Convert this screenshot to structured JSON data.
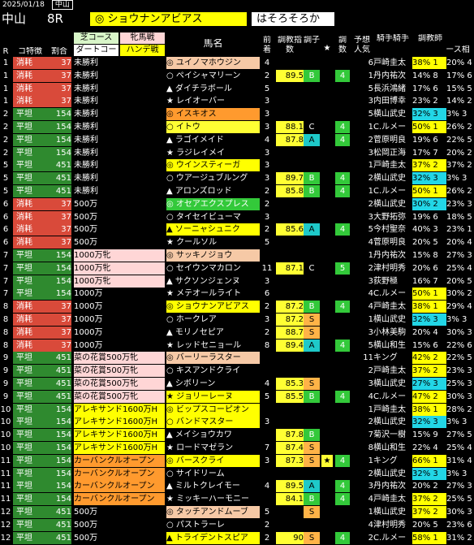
{
  "top": {
    "date": "2025/01/18",
    "venue": "中山"
  },
  "title": {
    "venue": "中山",
    "race": "8R",
    "pick": "◎ ショウナンアビアス",
    "note": "はそろそろか"
  },
  "headers": {
    "r": "R",
    "cond": "コ特徴",
    "ratio": "割合",
    "course_turf": "芝コース",
    "course_dirt": "ダートコー",
    "mare": "牝馬戦",
    "handicap": "ハンデ戦",
    "horse": "馬名",
    "prev": "前着",
    "index": "調教指数",
    "cond2": "調子",
    "star": "★",
    "cnt": "調数",
    "pred": "予想人気",
    "jockey": "騎手騎手",
    "trainer": "調教師",
    "rate": "ース相"
  },
  "rows": [
    {
      "r": "1",
      "feat": "消耗",
      "pct": "37",
      "cls": "未勝利",
      "mark": "◎",
      "name": "ユイノマホウジン",
      "nc": "peach",
      "prev": "4",
      "idx": "",
      "cnd": "",
      "cc": "",
      "star": "",
      "cnt": "",
      "pred": "6",
      "jk": "戸崎圭太",
      "pc": "38% 1",
      "pcc": "pc-y",
      "rt": "20% 4"
    },
    {
      "r": "1",
      "feat": "消耗",
      "pct": "37",
      "cls": "未勝利",
      "mark": "○",
      "name": "ペイシャマリーン",
      "nc": "",
      "prev": "2",
      "idx": "89.5",
      "cnd": "B",
      "cc": "rank-g",
      "star": "",
      "cnt": "4",
      "pred": "1",
      "jk": "丹内祐次",
      "pc": "14% 8",
      "pcc": "",
      "rt": "17% 6"
    },
    {
      "r": "1",
      "feat": "消耗",
      "pct": "37",
      "cls": "未勝利",
      "mark": "▲",
      "name": "ダイチラボール",
      "nc": "",
      "prev": "5",
      "idx": "",
      "cnd": "",
      "cc": "",
      "star": "",
      "cnt": "",
      "pred": "5",
      "jk": "長浜鴻緒",
      "pc": "17% 6",
      "pcc": "",
      "rt": "15% 5"
    },
    {
      "r": "1",
      "feat": "消耗",
      "pct": "37",
      "cls": "未勝利",
      "mark": "★",
      "name": "レイオーバー",
      "nc": "",
      "prev": "3",
      "idx": "",
      "cnd": "",
      "cc": "",
      "star": "",
      "cnt": "",
      "pred": "3",
      "jk": "内田博幸",
      "pc": "23% 2",
      "pcc": "",
      "rt": "14% 2"
    },
    {
      "r": "2",
      "feat": "平坦",
      "pct": "154",
      "cls": "未勝利",
      "mark": "◎",
      "name": "イスキオス",
      "nc": "orange",
      "prev": "3",
      "idx": "",
      "cnd": "",
      "cc": "",
      "star": "",
      "cnt": "",
      "pred": "5",
      "jk": "横山武史",
      "pc": "32% 3",
      "pcc": "pc-c",
      "rt": "3% 3"
    },
    {
      "r": "2",
      "feat": "平坦",
      "pct": "154",
      "cls": "未勝利",
      "mark": "○",
      "name": "イトウ",
      "nc": "lemon",
      "prev": "3",
      "idx": "88.1",
      "cnd": "C",
      "cc": "",
      "star": "",
      "cnt": "4",
      "pred": "1",
      "jk": "C.ルメー",
      "pc": "50% 1",
      "pcc": "pc-y",
      "rt": "26% 2"
    },
    {
      "r": "2",
      "feat": "平坦",
      "pct": "154",
      "cls": "未勝利",
      "mark": "▲",
      "name": "ラゴイメイド",
      "nc": "",
      "prev": "4",
      "idx": "87.8",
      "cnd": "A",
      "cc": "rank-c",
      "star": "",
      "cnt": "4",
      "pred": "2",
      "jk": "菅原明良",
      "pc": "19% 6",
      "pcc": "",
      "rt": "22% 5"
    },
    {
      "r": "2",
      "feat": "平坦",
      "pct": "154",
      "cls": "未勝利",
      "mark": "★",
      "name": "ラジレイメイ",
      "nc": "",
      "prev": "3",
      "idx": "",
      "cnd": "",
      "cc": "",
      "star": "",
      "cnt": "",
      "pred": "3",
      "jk": "松岡正海",
      "pc": "17% 7",
      "pcc": "",
      "rt": "20% 2"
    },
    {
      "r": "5",
      "feat": "平坦",
      "pct": "451",
      "cls": "未勝利",
      "mark": "◎",
      "name": "ウインスティーガ",
      "nc": "yel",
      "prev": "3",
      "idx": "",
      "cnd": "",
      "cc": "",
      "star": "",
      "cnt": "",
      "pred": "1",
      "jk": "戸崎圭太",
      "pc": "37% 2",
      "pcc": "pc-y",
      "rt": "37% 2"
    },
    {
      "r": "5",
      "feat": "平坦",
      "pct": "451",
      "cls": "未勝利",
      "mark": "○",
      "name": "ウアージュブルング",
      "nc": "",
      "prev": "3",
      "idx": "89.7",
      "cnd": "B",
      "cc": "rank-g",
      "star": "",
      "cnt": "4",
      "pred": "2",
      "jk": "横山武史",
      "pc": "32% 3",
      "pcc": "pc-c",
      "rt": "3% 3"
    },
    {
      "r": "5",
      "feat": "平坦",
      "pct": "451",
      "cls": "未勝利",
      "mark": "▲",
      "name": "アロンズロッド",
      "nc": "",
      "prev": "2",
      "idx": "85.8",
      "cnd": "B",
      "cc": "rank-g",
      "star": "",
      "cnt": "4",
      "pred": "1",
      "jk": "C.ルメー",
      "pc": "50% 1",
      "pcc": "pc-y",
      "rt": "26% 2"
    },
    {
      "r": "6",
      "feat": "消耗",
      "pct": "37",
      "cls": "500万",
      "mark": "◎",
      "name": "オセアエクスプレス",
      "nc": "rank-g",
      "prev": "2",
      "idx": "",
      "cnd": "",
      "cc": "",
      "star": "",
      "cnt": "",
      "pred": "2",
      "jk": "横山武史",
      "pc": "30% 2",
      "pcc": "pc-c",
      "rt": "23% 3"
    },
    {
      "r": "6",
      "feat": "消耗",
      "pct": "37",
      "cls": "500万",
      "mark": "○",
      "name": "タイセイビューマ",
      "nc": "",
      "prev": "3",
      "idx": "",
      "cnd": "",
      "cc": "",
      "star": "",
      "cnt": "",
      "pred": "3",
      "jk": "大野拓弥",
      "pc": "19% 6",
      "pcc": "",
      "rt": "18% 5"
    },
    {
      "r": "6",
      "feat": "消耗",
      "pct": "37",
      "cls": "500万",
      "mark": "▲",
      "name": "ソーニャシュニク",
      "nc": "yel",
      "prev": "2",
      "idx": "85.6",
      "cnd": "A",
      "cc": "rank-c",
      "star": "",
      "cnt": "4",
      "pred": "5",
      "jk": "今村聖奈",
      "pc": "40% 3",
      "pcc": "",
      "rt": "23% 1"
    },
    {
      "r": "6",
      "feat": "消耗",
      "pct": "37",
      "cls": "500万",
      "mark": "★",
      "name": "クールソル",
      "nc": "",
      "prev": "5",
      "idx": "",
      "cnd": "",
      "cc": "",
      "star": "",
      "cnt": "",
      "pred": "4",
      "jk": "菅原明良",
      "pc": "20% 5",
      "pcc": "",
      "rt": "20% 4"
    },
    {
      "r": "7",
      "feat": "平坦",
      "pct": "154",
      "cls": "1000万牝",
      "mark": "◎",
      "name": "サッキノジョウ",
      "nc": "peach",
      "prev": "",
      "idx": "",
      "cnd": "",
      "cc": "",
      "star": "",
      "cnt": "",
      "pred": "1",
      "jk": "丹内祐次",
      "pc": "15% 8",
      "pcc": "",
      "rt": "27% 3"
    },
    {
      "r": "7",
      "feat": "平坦",
      "pct": "154",
      "cls": "1000万牝",
      "mark": "○",
      "name": "セイウンマカロン",
      "nc": "",
      "prev": "11",
      "idx": "87.1",
      "cnd": "C",
      "cc": "",
      "star": "",
      "cnt": "5",
      "pred": "2",
      "jk": "津村明秀",
      "pc": "20% 6",
      "pcc": "",
      "rt": "25% 4"
    },
    {
      "r": "7",
      "feat": "平坦",
      "pct": "154",
      "cls": "1000万牝",
      "mark": "▲",
      "name": "サクソンジェンヌ",
      "nc": "",
      "prev": "3",
      "idx": "",
      "cnd": "",
      "cc": "",
      "star": "",
      "cnt": "",
      "pred": "3",
      "jk": "荻野極",
      "pc": "16% 7",
      "pcc": "",
      "rt": "20% 5"
    },
    {
      "r": "7",
      "feat": "平坦",
      "pct": "154",
      "cls": "1000万",
      "mark": "★",
      "name": "メテオールライト",
      "nc": "",
      "prev": "6",
      "idx": "",
      "cnd": "",
      "cc": "",
      "star": "",
      "cnt": "",
      "pred": "4",
      "jk": "C.ルメー",
      "pc": "50% 1",
      "pcc": "pc-y",
      "rt": "30% 2"
    },
    {
      "r": "8",
      "feat": "消耗",
      "pct": "37",
      "cls": "1000万",
      "mark": "◎",
      "name": "ショウナンアビアス",
      "nc": "yel",
      "prev": "2",
      "idx": "87.2",
      "cnd": "B",
      "cc": "rank-g",
      "star": "",
      "cnt": "4",
      "pred": "4",
      "jk": "戸崎圭太",
      "pc": "38% 1",
      "pcc": "pc-y",
      "rt": "29% 4"
    },
    {
      "r": "8",
      "feat": "消耗",
      "pct": "37",
      "cls": "1000万",
      "mark": "○",
      "name": "ホークレア",
      "nc": "",
      "prev": "3",
      "idx": "87.2",
      "cnd": "S",
      "cc": "pc-o",
      "star": "",
      "cnt": "",
      "pred": "1",
      "jk": "横山武史",
      "pc": "32% 3",
      "pcc": "pc-c",
      "rt": "3% 3"
    },
    {
      "r": "8",
      "feat": "消耗",
      "pct": "37",
      "cls": "1000万",
      "mark": "▲",
      "name": "モリノセピア",
      "nc": "",
      "prev": "2",
      "idx": "88.7",
      "cnd": "S",
      "cc": "pc-o",
      "star": "",
      "cnt": "",
      "pred": "3",
      "jk": "小林美駒",
      "pc": "20% 4",
      "pcc": "",
      "rt": "30% 3"
    },
    {
      "r": "8",
      "feat": "消耗",
      "pct": "37",
      "cls": "1000万",
      "mark": "★",
      "name": "レッドセニョール",
      "nc": "",
      "prev": "8",
      "idx": "89.4",
      "cnd": "A",
      "cc": "rank-c",
      "star": "",
      "cnt": "4",
      "pred": "5",
      "jk": "横山和生",
      "pc": "15% 6",
      "pcc": "",
      "rt": "22% 6"
    },
    {
      "r": "9",
      "feat": "平坦",
      "pct": "451",
      "cls": "菜の花賞500万牝",
      "mark": "◎",
      "name": "バーリーラスター",
      "nc": "peach",
      "prev": "",
      "idx": "",
      "cnd": "",
      "cc": "",
      "star": "",
      "cnt": "",
      "pred": "11",
      "jk": "キング",
      "pc": "42% 2",
      "pcc": "pc-y",
      "rt": "22% 5"
    },
    {
      "r": "9",
      "feat": "平坦",
      "pct": "451",
      "cls": "菜の花賞500万牝",
      "mark": "○",
      "name": "キスアンドクライ",
      "nc": "",
      "prev": "",
      "idx": "",
      "cnd": "",
      "cc": "",
      "star": "",
      "cnt": "",
      "pred": "2",
      "jk": "戸崎圭太",
      "pc": "37% 2",
      "pcc": "pc-y",
      "rt": "23% 3"
    },
    {
      "r": "9",
      "feat": "平坦",
      "pct": "451",
      "cls": "菜の花賞500万牝",
      "mark": "▲",
      "name": "シボリーン",
      "nc": "",
      "prev": "4",
      "idx": "85.3",
      "cnd": "S",
      "cc": "pc-o",
      "star": "",
      "cnt": "",
      "pred": "3",
      "jk": "横山武史",
      "pc": "27% 3",
      "pcc": "pc-c",
      "rt": "25% 3"
    },
    {
      "r": "9",
      "feat": "平坦",
      "pct": "451",
      "cls": "菜の花賞500万牝",
      "mark": "★",
      "name": "ジョリーレーヌ",
      "nc": "yel",
      "prev": "5",
      "idx": "85.5",
      "cnd": "B",
      "cc": "rank-g",
      "star": "",
      "cnt": "4",
      "pred": "4",
      "jk": "C.ルメー",
      "pc": "47% 2",
      "pcc": "pc-y",
      "rt": "30% 3"
    },
    {
      "r": "10",
      "feat": "平坦",
      "pct": "154",
      "cls": "アレキサンド1600万H",
      "mark": "◎",
      "name": "ビップスコーピオン",
      "nc": "yel",
      "prev": "",
      "idx": "",
      "cnd": "",
      "cc": "",
      "star": "",
      "cnt": "",
      "pred": "1",
      "jk": "戸崎圭太",
      "pc": "38% 1",
      "pcc": "pc-y",
      "rt": "28% 2"
    },
    {
      "r": "10",
      "feat": "平坦",
      "pct": "154",
      "cls": "アレキサンド1600万H",
      "mark": "○",
      "name": "バンドマスター",
      "nc": "yel",
      "prev": "3",
      "idx": "",
      "cnd": "",
      "cc": "",
      "star": "",
      "cnt": "",
      "pred": "2",
      "jk": "横山武史",
      "pc": "32% 3",
      "pcc": "pc-c",
      "rt": "3% 3"
    },
    {
      "r": "10",
      "feat": "平坦",
      "pct": "154",
      "cls": "アレキサンド1600万H",
      "mark": "▲",
      "name": "メイショウカワ",
      "nc": "",
      "prev": "",
      "idx": "87.8",
      "cnd": "B",
      "cc": "rank-g",
      "star": "",
      "cnt": "",
      "pred": "7",
      "jk": "菊沢一樹",
      "pc": "15% 9",
      "pcc": "",
      "rt": "27% 5"
    },
    {
      "r": "10",
      "feat": "平坦",
      "pct": "154",
      "cls": "アレキサンド1600万H",
      "mark": "★",
      "name": "ロードマゼラン",
      "nc": "",
      "prev": "7",
      "idx": "87.4",
      "cnd": "S",
      "cc": "pc-o",
      "star": "",
      "cnt": "",
      "pred": "8",
      "jk": "横山和生",
      "pc": "22% 4",
      "pcc": "",
      "rt": "25% 4"
    },
    {
      "r": "11",
      "feat": "平坦",
      "pct": "154",
      "cls": "カーバンクルオープン",
      "mark": "◎",
      "name": "バースクライ",
      "nc": "yel",
      "prev": "3",
      "idx": "87.3",
      "cnd": "S",
      "cc": "pc-o",
      "star": "★",
      "cnt": "4",
      "pred": "1",
      "jk": "キング",
      "pc": "66% 1",
      "pcc": "pc-y",
      "rt": "31% 4"
    },
    {
      "r": "11",
      "feat": "平坦",
      "pct": "154",
      "cls": "カーバンクルオープン",
      "mark": "○",
      "name": "サイドリーム",
      "nc": "",
      "prev": "",
      "idx": "",
      "cnd": "",
      "cc": "",
      "star": "",
      "cnt": "",
      "pred": "2",
      "jk": "横山武史",
      "pc": "32% 3",
      "pcc": "pc-c",
      "rt": "3% 3"
    },
    {
      "r": "11",
      "feat": "平坦",
      "pct": "154",
      "cls": "カーバンクルオープン",
      "mark": "▲",
      "name": "ミルトクレイモー",
      "nc": "",
      "prev": "4",
      "idx": "89.5",
      "cnd": "A",
      "cc": "rank-c",
      "star": "",
      "cnt": "4",
      "pred": "3",
      "jk": "丹内祐次",
      "pc": "20% 2",
      "pcc": "",
      "rt": "27% 3"
    },
    {
      "r": "11",
      "feat": "平坦",
      "pct": "154",
      "cls": "カーバンクルオープン",
      "mark": "★",
      "name": "ミッキーハーモニー",
      "nc": "",
      "prev": "",
      "idx": "84.1",
      "cnd": "B",
      "cc": "rank-g",
      "star": "",
      "cnt": "4",
      "pred": "4",
      "jk": "戸崎圭太",
      "pc": "37% 2",
      "pcc": "pc-y",
      "rt": "25% 5"
    },
    {
      "r": "12",
      "feat": "平坦",
      "pct": "451",
      "cls": "500万",
      "mark": "◎",
      "name": "タッチアンドムーブ",
      "nc": "peach",
      "prev": "5",
      "idx": "",
      "cnd": "S",
      "cc": "pc-o",
      "star": "",
      "cnt": "",
      "pred": "1",
      "jk": "横山武史",
      "pc": "37% 2",
      "pcc": "pc-y",
      "rt": "30% 3"
    },
    {
      "r": "12",
      "feat": "平坦",
      "pct": "451",
      "cls": "500万",
      "mark": "○",
      "name": "パストラーレ",
      "nc": "",
      "prev": "2",
      "idx": "",
      "cnd": "",
      "cc": "",
      "star": "",
      "cnt": "",
      "pred": "4",
      "jk": "津村明秀",
      "pc": "20% 5",
      "pcc": "",
      "rt": "23% 6"
    },
    {
      "r": "12",
      "feat": "平坦",
      "pct": "451",
      "cls": "500万",
      "mark": "▲",
      "name": "トライデントスピア",
      "nc": "yel",
      "prev": "2",
      "idx": "90",
      "cnd": "S",
      "cc": "pc-o",
      "star": "",
      "cnt": "4",
      "pred": "2",
      "jk": "C.ルメー",
      "pc": "58% 1",
      "pcc": "pc-y",
      "rt": "31% 2"
    }
  ]
}
